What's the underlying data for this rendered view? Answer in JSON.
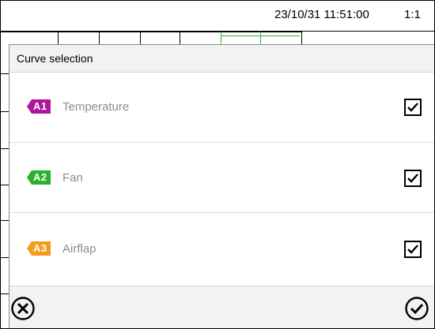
{
  "statusbar": {
    "datetime": "23/10/31 11:51:00",
    "page": "1:1"
  },
  "dialog": {
    "title": "Curve selection",
    "items": [
      {
        "tag": "A1",
        "label": "Temperature",
        "color": "#b0169c",
        "checked": true
      },
      {
        "tag": "A2",
        "label": "Fan",
        "color": "#27b22a",
        "checked": true
      },
      {
        "tag": "A3",
        "label": "Airflap",
        "color": "#f59a1c",
        "checked": true
      }
    ],
    "buttons": {
      "cancel_icon": "circle-x-icon",
      "confirm_icon": "circle-check-icon"
    }
  },
  "colors": {
    "label_gray": "#8c8c8c",
    "panel_bg": "#f2f2f2"
  }
}
